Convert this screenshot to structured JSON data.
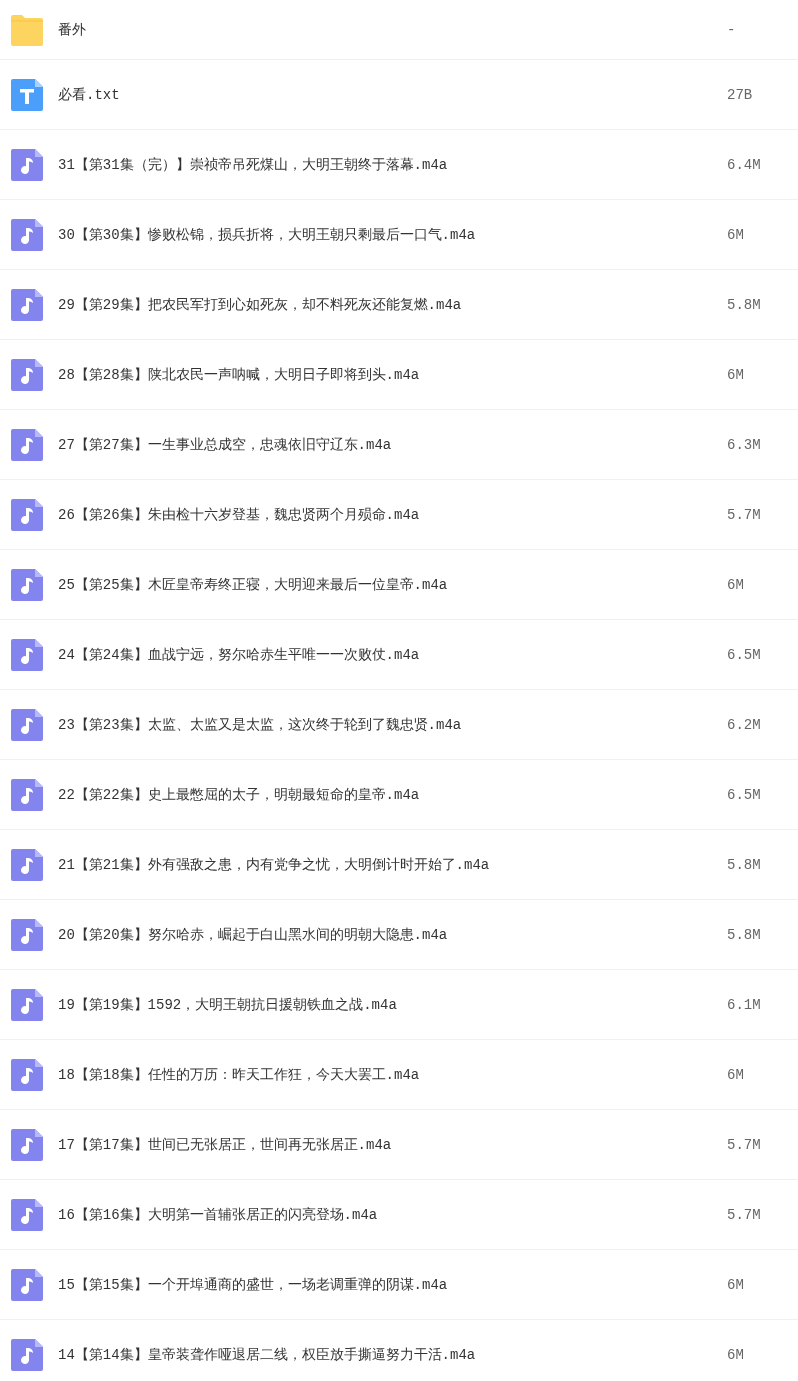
{
  "files": [
    {
      "kind": "folder",
      "name": "番外",
      "size": "-"
    },
    {
      "kind": "text",
      "name": "必看.txt",
      "size": "27B"
    },
    {
      "kind": "audio",
      "name": "31【第31集（完）】崇祯帝吊死煤山，大明王朝终于落幕.m4a",
      "size": "6.4M"
    },
    {
      "kind": "audio",
      "name": "30【第30集】惨败松锦，损兵折将，大明王朝只剩最后一口气.m4a",
      "size": "6M"
    },
    {
      "kind": "audio",
      "name": "29【第29集】把农民军打到心如死灰，却不料死灰还能复燃.m4a",
      "size": "5.8M"
    },
    {
      "kind": "audio",
      "name": "28【第28集】陕北农民一声呐喊，大明日子即将到头.m4a",
      "size": "6M"
    },
    {
      "kind": "audio",
      "name": "27【第27集】一生事业总成空，忠魂依旧守辽东.m4a",
      "size": "6.3M"
    },
    {
      "kind": "audio",
      "name": "26【第26集】朱由检十六岁登基，魏忠贤两个月殒命.m4a",
      "size": "5.7M"
    },
    {
      "kind": "audio",
      "name": "25【第25集】木匠皇帝寿终正寝，大明迎来最后一位皇帝.m4a",
      "size": "6M"
    },
    {
      "kind": "audio",
      "name": "24【第24集】血战宁远，努尔哈赤生平唯一一次败仗.m4a",
      "size": "6.5M"
    },
    {
      "kind": "audio",
      "name": "23【第23集】太监、太监又是太监，这次终于轮到了魏忠贤.m4a",
      "size": "6.2M"
    },
    {
      "kind": "audio",
      "name": "22【第22集】史上最憋屈的太子，明朝最短命的皇帝.m4a",
      "size": "6.5M"
    },
    {
      "kind": "audio",
      "name": "21【第21集】外有强敌之患，内有党争之忧，大明倒计时开始了.m4a",
      "size": "5.8M"
    },
    {
      "kind": "audio",
      "name": "20【第20集】努尔哈赤，崛起于白山黑水间的明朝大隐患.m4a",
      "size": "5.8M"
    },
    {
      "kind": "audio",
      "name": "19【第19集】1592，大明王朝抗日援朝铁血之战.m4a",
      "size": "6.1M"
    },
    {
      "kind": "audio",
      "name": "18【第18集】任性的万历：昨天工作狂，今天大罢工.m4a",
      "size": "6M"
    },
    {
      "kind": "audio",
      "name": "17【第17集】世间已无张居正，世间再无张居正.m4a",
      "size": "5.7M"
    },
    {
      "kind": "audio",
      "name": "16【第16集】大明第一首辅张居正的闪亮登场.m4a",
      "size": "5.7M"
    },
    {
      "kind": "audio",
      "name": "15【第15集】一个开埠通商的盛世，一场老调重弹的阴谋.m4a",
      "size": "6M"
    },
    {
      "kind": "audio",
      "name": "14【第14集】皇帝装聋作哑退居二线，权臣放手撕逼努力干活.m4a",
      "size": "6M"
    }
  ]
}
